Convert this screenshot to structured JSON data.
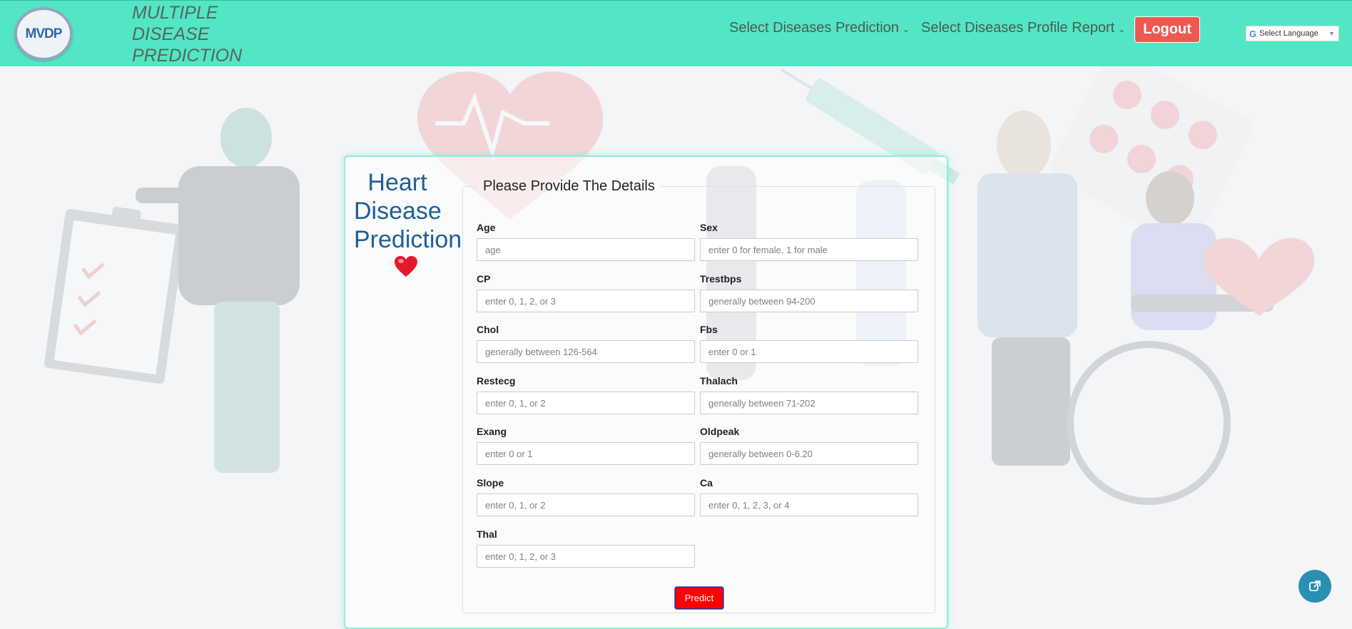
{
  "navbar": {
    "logo_text": "MVDP",
    "brand": "MULTIPLE DISEASE PREDICTION",
    "menu": [
      {
        "label": "Select Diseases Prediction"
      },
      {
        "label": "Select Diseases Profile Report"
      }
    ],
    "logout_label": "Logout",
    "language_label": "Select Language"
  },
  "page": {
    "side_title": "Heart Disease Prediction",
    "legend": "Please Provide The Details",
    "fields": [
      {
        "label": "Age",
        "placeholder": "age",
        "value": ""
      },
      {
        "label": "Sex",
        "placeholder": "enter 0 for female, 1 for male",
        "value": ""
      },
      {
        "label": "CP",
        "placeholder": "enter 0, 1, 2, or 3",
        "value": ""
      },
      {
        "label": "Trestbps",
        "placeholder": "generally between 94-200",
        "value": ""
      },
      {
        "label": "Chol",
        "placeholder": "generally between 126-564",
        "value": ""
      },
      {
        "label": "Fbs",
        "placeholder": "enter 0 or 1",
        "value": ""
      },
      {
        "label": "Restecg",
        "placeholder": "enter 0, 1, or 2",
        "value": ""
      },
      {
        "label": "Thalach",
        "placeholder": "generally between 71-202",
        "value": ""
      },
      {
        "label": "Exang",
        "placeholder": "enter 0 or 1",
        "value": ""
      },
      {
        "label": "Oldpeak",
        "placeholder": "generally between 0-6.20",
        "value": ""
      },
      {
        "label": "Slope",
        "placeholder": "enter 0, 1, or 2",
        "value": ""
      },
      {
        "label": "Ca",
        "placeholder": "enter 0, 1, 2, 3, or 4",
        "value": ""
      },
      {
        "label": "Thal",
        "placeholder": "enter 0, 1, 2, or 3",
        "value": ""
      }
    ],
    "predict_label": "Predict"
  },
  "colors": {
    "navbar": "#52e6c4",
    "logout": "#f0574f",
    "predict": "#ff0000",
    "title": "#1f5f96"
  },
  "icons": [
    "heart-icon",
    "google-icon",
    "chevron-down-icon",
    "external-link-icon"
  ]
}
